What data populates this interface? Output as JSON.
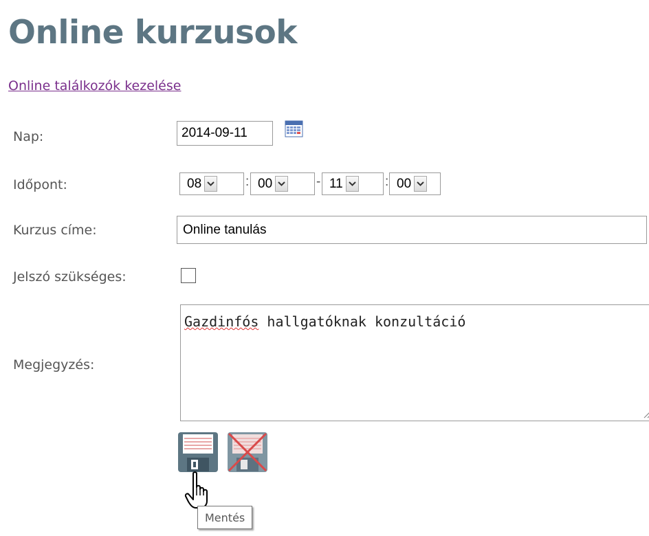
{
  "page": {
    "title": "Online kurzusok",
    "manage_link": "Online találkozók kezelése"
  },
  "form": {
    "day": {
      "label": "Nap:",
      "value": "2014-09-11"
    },
    "time": {
      "label": "Időpont:",
      "start_hour": "08",
      "start_minute": "00",
      "end_hour": "11",
      "end_minute": "00",
      "time_separator": ":",
      "range_separator": "-"
    },
    "course_title": {
      "label": "Kurzus címe:",
      "value": "Online tanulás"
    },
    "password_required": {
      "label": "Jelszó szükséges:",
      "checked": false
    },
    "note": {
      "label": "Megjegyzés:",
      "value_misspelled": "Gazdinfós",
      "value_rest": " hallgatóknak konzultáció"
    }
  },
  "actions": {
    "save_tooltip": "Mentés"
  },
  "icons": {
    "calendar": "calendar-icon",
    "save": "floppy-disk-icon",
    "cancel": "floppy-disk-crossed-icon",
    "cursor": "hand-pointer-icon"
  },
  "colors": {
    "title": "#5d7683",
    "link": "#7a2f8c",
    "label": "#555555",
    "floppy": "#5d7683",
    "cancel_cross": "#d94a4a"
  }
}
